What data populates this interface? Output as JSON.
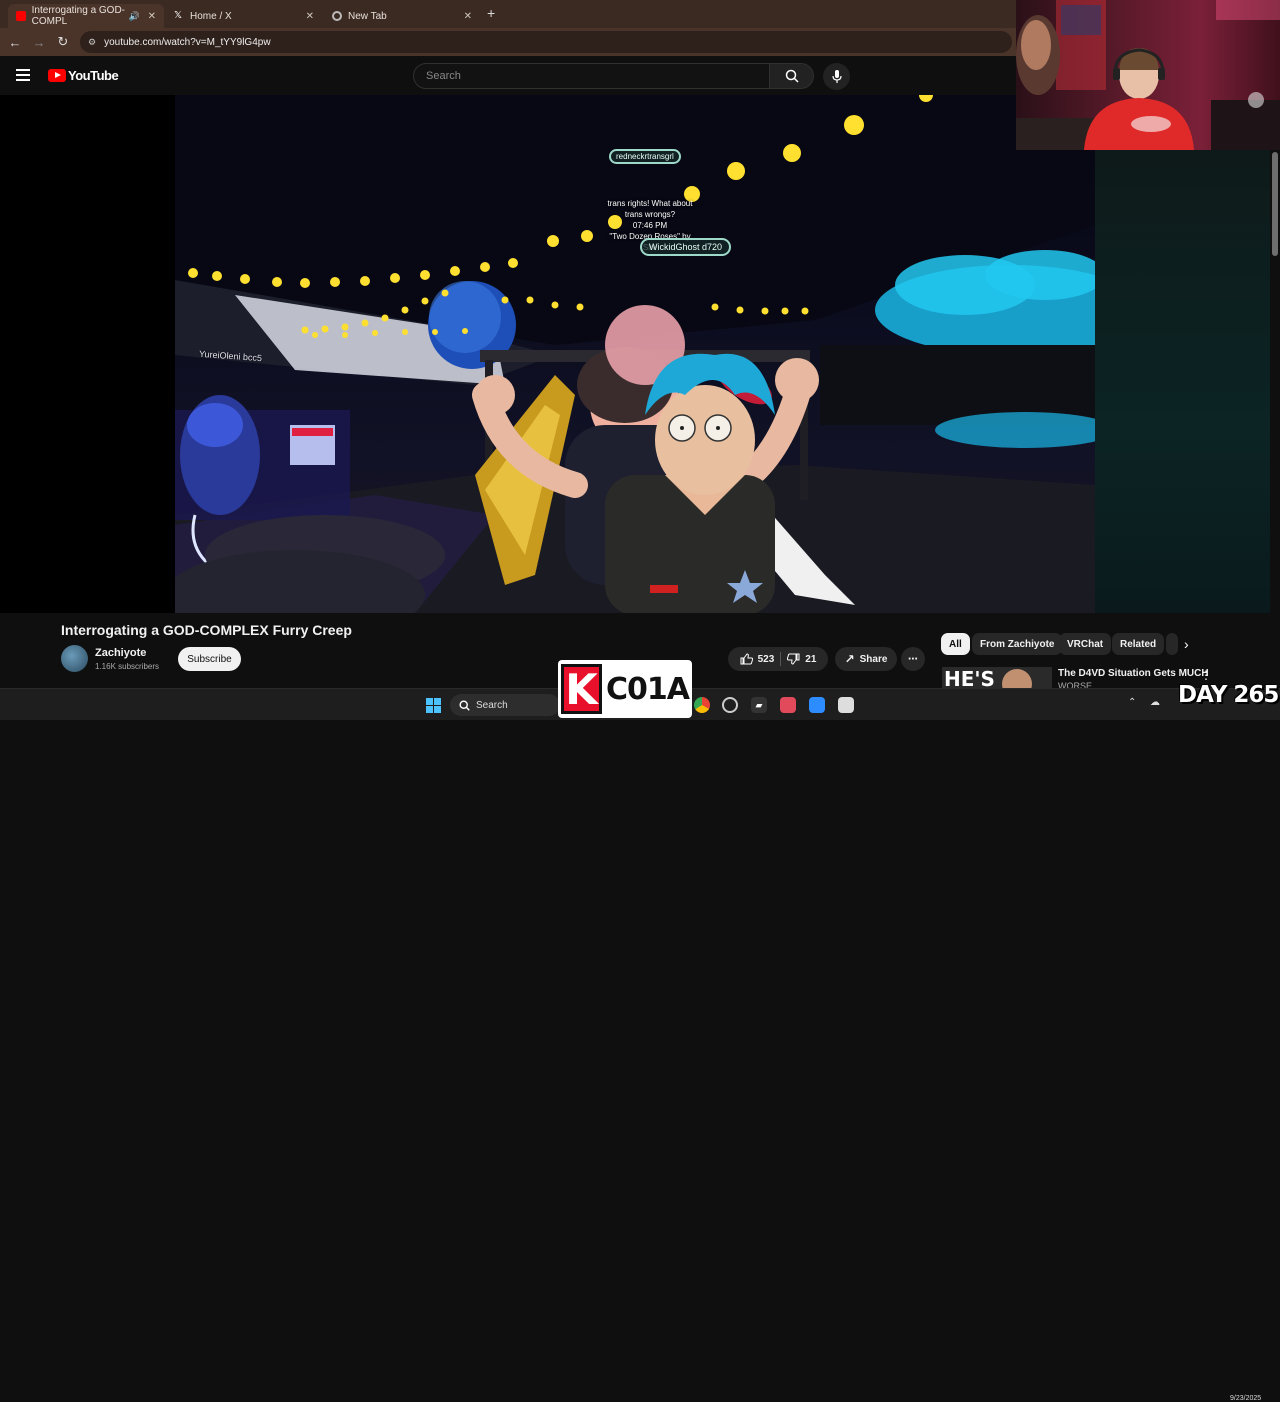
{
  "browser": {
    "tabs": [
      {
        "title": "Interrogating a GOD-COMPL",
        "active": true,
        "icon": "youtube-favicon"
      },
      {
        "title": "Home / X",
        "active": false,
        "icon": "x-favicon"
      },
      {
        "title": "New Tab",
        "active": false,
        "icon": "chrome-favicon"
      }
    ],
    "url": "youtube.com/watch?v=M_tYY9lG4pw"
  },
  "youtube": {
    "logo_text": "YouTube",
    "search_placeholder": "Search"
  },
  "video": {
    "scene": {
      "nameplate_top": "redneckrtransgrl",
      "chat_line1": "trans rights! What about",
      "chat_line2": "trans wrongs?",
      "chat_time": "07:46 PM",
      "chat_song": "\"Two Dozen Roses\" by",
      "chat_song2": "She",
      "nameplate_main": "WickidGhost d720",
      "nameplate_left": "YureiOleni bcc5"
    },
    "title": "Interrogating a GOD-COMPLEX Furry Creep",
    "channel": {
      "name": "Zachiyote",
      "subscribers": "1.16K subscribers",
      "subscribe_label": "Subscribe"
    },
    "actions": {
      "likes": "523",
      "dislikes": "21",
      "share_label": "Share"
    }
  },
  "recommendations": {
    "chips": [
      {
        "label": "All",
        "active": true
      },
      {
        "label": "From Zachiyote",
        "active": false
      },
      {
        "label": "VRChat",
        "active": false
      },
      {
        "label": "Related",
        "active": false
      }
    ],
    "first_item": {
      "title": "The D4VD Situation Gets MUCH",
      "subtitle": "WORSE",
      "thumb_text": "HE'S"
    }
  },
  "taskbar": {
    "search_label": "Search",
    "date": "9/23/2025"
  },
  "overlays": {
    "logo_letter": "K",
    "logo_code": "C01A",
    "day_counter": "DAY 265"
  },
  "colors": {
    "youtube_red": "#ff0000",
    "chrome_tab": "#4a342a",
    "windows_blue": "#4cc2ff"
  }
}
